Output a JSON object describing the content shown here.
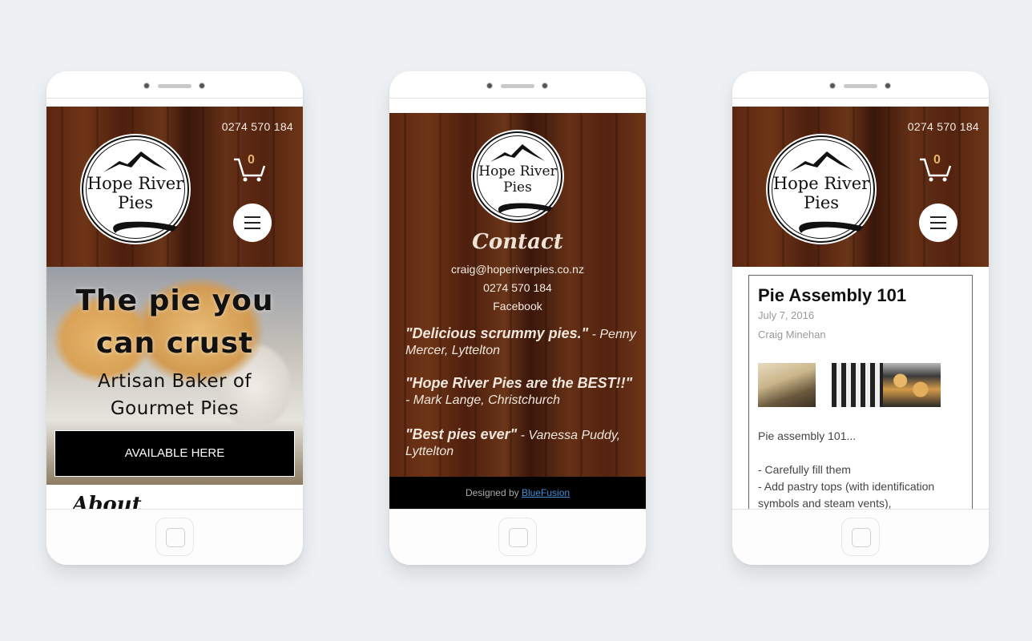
{
  "brand": {
    "logo_line1": "Hope River",
    "logo_line2": "Pies",
    "phone": "0274 570 184",
    "cart_count": "0",
    "accent_cart_count": "#e8b46a"
  },
  "home": {
    "hero_title_line1": "The pie you",
    "hero_title_line2": "can crust",
    "hero_sub_line1": "Artisan Baker of",
    "hero_sub_line2": "Gourmet Pies",
    "cta_label": "AVAILABLE HERE",
    "section_heading": "About"
  },
  "contact": {
    "heading": "Contact",
    "email": "craig@hoperiverpies.co.nz",
    "phone": "0274 570 184",
    "facebook_label": "Facebook",
    "testimonials": [
      {
        "quote": "\"Delicious scrummy pies.\"",
        "author": " - Penny Mercer, Lyttelton"
      },
      {
        "quote": "\"Hope River Pies are the BEST!!\"",
        "author": "- Mark Lange, Christchurch"
      },
      {
        "quote": "\"Best pies ever\"",
        "author": " - Vanessa Puddy, Lyttelton"
      }
    ],
    "footer_prefix": "Designed by ",
    "footer_link": "BlueFusion"
  },
  "blog": {
    "title": "Pie Assembly 101",
    "date": "July 7, 2016",
    "author": "Craig Minehan",
    "images": [
      "pies-in-trays-photo",
      "pie-assembly-line-photo",
      "baked-pies-photo"
    ],
    "body_line1": "Pie assembly 101...",
    "body_line2": "- Carefully fill them",
    "body_line3": "- Add pastry tops (with identification symbols and steam vents),"
  }
}
